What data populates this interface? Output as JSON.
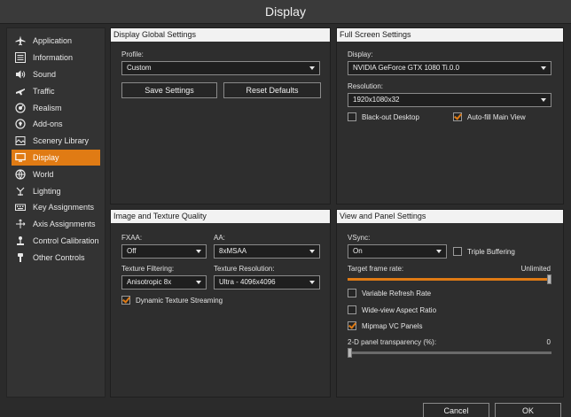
{
  "window": {
    "title": "Display"
  },
  "sidebar": {
    "items": [
      {
        "label": "Application",
        "icon": "airplane-icon"
      },
      {
        "label": "Information",
        "icon": "info-list-icon"
      },
      {
        "label": "Sound",
        "icon": "speaker-icon"
      },
      {
        "label": "Traffic",
        "icon": "airplane-traffic-icon"
      },
      {
        "label": "Realism",
        "icon": "gauge-icon"
      },
      {
        "label": "Add-ons",
        "icon": "puzzle-icon"
      },
      {
        "label": "Scenery Library",
        "icon": "globe-icon"
      },
      {
        "label": "Display",
        "icon": "monitor-icon"
      },
      {
        "label": "World",
        "icon": "globe-world-icon"
      },
      {
        "label": "Lighting",
        "icon": "lightbulb-icon"
      },
      {
        "label": "Key Assignments",
        "icon": "keyboard-icon"
      },
      {
        "label": "Axis Assignments",
        "icon": "axis-icon"
      },
      {
        "label": "Control Calibration",
        "icon": "joystick-icon"
      },
      {
        "label": "Other Controls",
        "icon": "throttle-icon"
      }
    ],
    "active_index": 7
  },
  "global": {
    "title": "Display Global Settings",
    "profile_label": "Profile:",
    "profile_value": "Custom",
    "save_label": "Save Settings",
    "reset_label": "Reset Defaults"
  },
  "fullscreen": {
    "title": "Full Screen Settings",
    "display_label": "Display:",
    "display_value": "NVIDIA GeForce GTX 1080 Ti.0.0",
    "resolution_label": "Resolution:",
    "resolution_value": "1920x1080x32",
    "blackout_label": "Black-out Desktop",
    "blackout_checked": false,
    "autofill_label": "Auto-fill Main View",
    "autofill_checked": true
  },
  "texture": {
    "title": "Image and Texture Quality",
    "fxaa_label": "FXAA:",
    "fxaa_value": "Off",
    "aa_label": "AA:",
    "aa_value": "8xMSAA",
    "filter_label": "Texture Filtering:",
    "filter_value": "Anisotropic 8x",
    "res_label": "Texture Resolution:",
    "res_value": "Ultra - 4096x4096",
    "streaming_label": "Dynamic Texture Streaming",
    "streaming_checked": true
  },
  "view": {
    "title": "View and Panel Settings",
    "vsync_label": "VSync:",
    "vsync_value": "On",
    "triple_label": "Triple Buffering",
    "triple_checked": false,
    "framerate_label": "Target frame rate:",
    "framerate_value": "Unlimited",
    "framerate_fraction": 1.0,
    "vrr_label": "Variable Refresh Rate",
    "vrr_checked": false,
    "wide_label": "Wide-view Aspect Ratio",
    "wide_checked": false,
    "mipmap_label": "Mipmap VC Panels",
    "mipmap_checked": true,
    "transparency_label": "2-D panel transparency (%):",
    "transparency_value": "0"
  },
  "footer": {
    "cancel_label": "Cancel",
    "ok_label": "OK"
  },
  "colors": {
    "accent": "#e07b14",
    "background": "#2b2b2b",
    "panel_header": "#f2f2f2"
  }
}
